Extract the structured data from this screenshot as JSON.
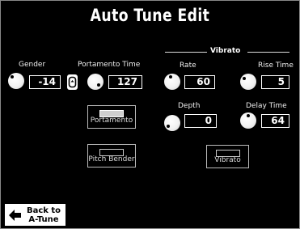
{
  "title": "Auto Tune Edit",
  "vibrato_group_label": "Vibrato",
  "gender": {
    "label": "Gender",
    "value": "-14"
  },
  "portamento_time": {
    "label": "Portamento Time",
    "value": "127"
  },
  "rate": {
    "label": "Rate",
    "value": "60"
  },
  "rise_time": {
    "label": "Rise Time",
    "value": "5"
  },
  "depth": {
    "label": "Depth",
    "value": "0"
  },
  "delay_time": {
    "label": "Delay Time",
    "value": "64"
  },
  "buttons": {
    "portamento": {
      "label": "Portamento",
      "on": true
    },
    "pitch_bender": {
      "label": "Pitch Bender",
      "on": false
    },
    "vibrato": {
      "label": "Vibrato",
      "on": false
    }
  },
  "back": {
    "line1": "Back to",
    "line2": "A-Tune"
  }
}
